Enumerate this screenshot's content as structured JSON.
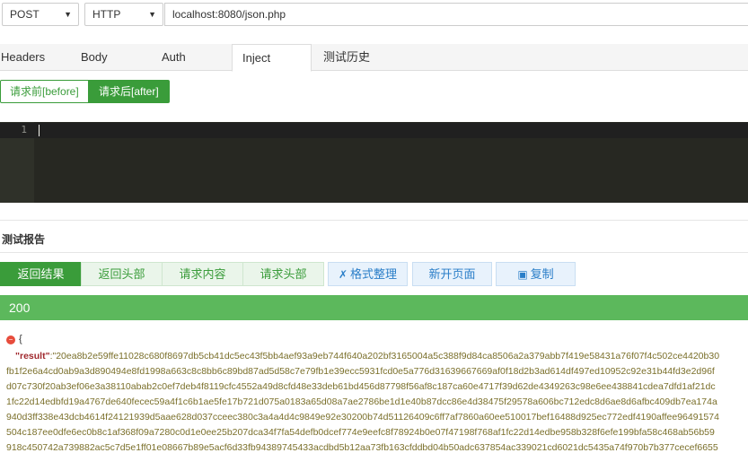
{
  "request": {
    "method": "POST",
    "protocol": "HTTP",
    "url": "localhost:8080/json.php"
  },
  "tabs": [
    "Headers",
    "Body",
    "Auth",
    "Inject",
    "测试历史"
  ],
  "active_tab": "Inject",
  "inject": {
    "before_label": "请求前[before]",
    "after_label": "请求后[after]",
    "active": "after",
    "line_number": "1"
  },
  "report": {
    "title": "测试报告",
    "buttons": {
      "response_body": "返回结果",
      "response_headers": "返回头部",
      "request_body": "请求内容",
      "request_headers": "请求头部",
      "format": "格式整理",
      "new_page": "新开页面",
      "copy": "复制"
    },
    "status_code": "200",
    "json": {
      "open_brace": "{",
      "key": "\"result\"",
      "lines": [
        ":\"20ea8b2e59ffe11028c680f8697db5cb41dc5ec43f5bb4aef93a9eb744f640a202bf3165004a5c388f9d84ca8506a2a379abb7f419e58431a76f07f4c502ce4420b30",
        "fb1f2e6a4cd0ab9a3d890494e8fd1998a663c8c8bb6c89bd87ad5d58c7e79fb1e39ecc5931fcd0e5a776d31639667669af0f18d2b3ad614df497ed10952c92e31b44fd3e2d96f",
        "d07c730f20ab3ef06e3a38110abab2c0ef7deb4f8119cfc4552a49d8cfd48e33deb61bd456d87798f56af8c187ca60e4717f39d62de4349263c98e6ee438841cdea7dfd1af21dc",
        "1fc22d14edbfd19a4767de640fecec59a4f1c6b1ae5fe17b721d075a0183a65d08a7ae2786be1d1e40b87dcc86e4d38475f29578a606bc712edc8d6ae8d6afbc409db7ea174a",
        "940d3ff338e43dcb4614f24121939d5aae628d037cceec380c3a4a4d4c9849e92e30200b74d51126409c6ff7af7860a60ee510017bef16488d925ec772edf4190affee96491574",
        "504c187ee0dfe6ec0b8c1af368f09a7280c0d1e0ee25b207dca34f7fa54defb0dcef774e9eefc8f78924b0e07f47198f768af1fc22d14edbe958b328f6efe199bfa58c468ab56b59",
        "918c450742a739882ac5c7d5e1ff01e08667b89e5acf6d33fb94389745433acdbd5b12aa73fb163cfddbd04b50adc637854ac339021cd6021dc5435a74f970b7b377cecef6655"
      ]
    }
  },
  "colors": {
    "green": "#5cb85c",
    "dark_green": "#3a9c3a",
    "blue": "#2a7ec8",
    "editor_bg": "#272822",
    "json_key": "#a0282d",
    "json_value": "#7a6f2a"
  }
}
